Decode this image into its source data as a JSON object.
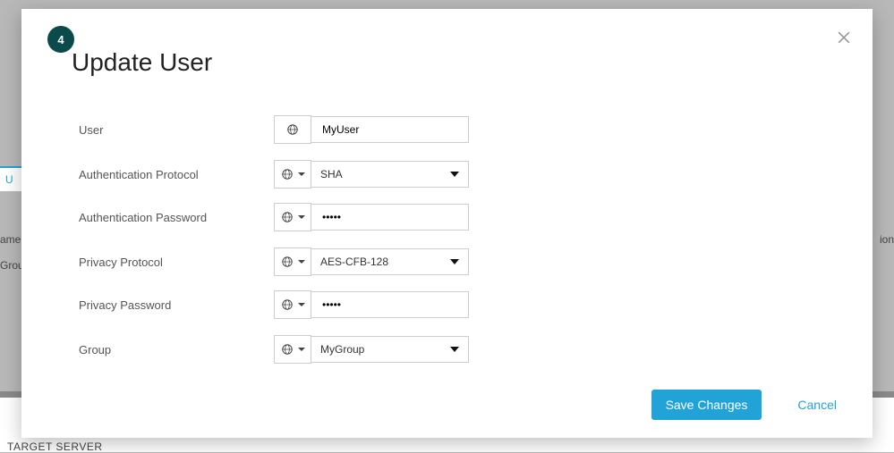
{
  "background": {
    "tab_partial_left": "U",
    "field_name_partial": "ame",
    "field_group_partial": "Grou",
    "field_ion_partial": "ion",
    "target_server": "TARGET SERVER"
  },
  "step_number": "4",
  "title": "Update User",
  "fields": {
    "user": {
      "label": "User",
      "value": "MyUser"
    },
    "auth_protocol": {
      "label": "Authentication Protocol",
      "value": "SHA"
    },
    "auth_password": {
      "label": "Authentication Password",
      "value": "•••••"
    },
    "priv_protocol": {
      "label": "Privacy Protocol",
      "value": "AES-CFB-128"
    },
    "priv_password": {
      "label": "Privacy Password",
      "value": "•••••"
    },
    "group": {
      "label": "Group",
      "value": "MyGroup"
    }
  },
  "buttons": {
    "save": "Save Changes",
    "cancel": "Cancel"
  }
}
